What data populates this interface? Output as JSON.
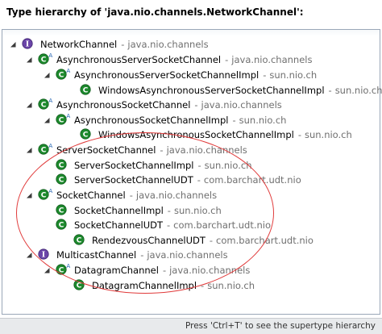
{
  "header": {
    "title": "Type hierarchy of 'java.nio.channels.NetworkChannel':"
  },
  "tree": {
    "rows": [
      {
        "name": "NetworkChannel",
        "pkg": "java.nio.channels",
        "icon": "interface-icon"
      },
      {
        "name": "AsynchronousServerSocketChannel",
        "pkg": "java.nio.channels",
        "icon": "abstract-class-icon"
      },
      {
        "name": "AsynchronousServerSocketChannelImpl",
        "pkg": "sun.nio.ch",
        "icon": "abstract-class-icon"
      },
      {
        "name": "WindowsAsynchronousServerSocketChannelImpl",
        "pkg": "sun.nio.ch",
        "icon": "class-icon"
      },
      {
        "name": "AsynchronousSocketChannel",
        "pkg": "java.nio.channels",
        "icon": "abstract-class-icon"
      },
      {
        "name": "AsynchronousSocketChannelImpl",
        "pkg": "sun.nio.ch",
        "icon": "abstract-class-icon"
      },
      {
        "name": "WindowsAsynchronousSocketChannelImpl",
        "pkg": "sun.nio.ch",
        "icon": "class-icon"
      },
      {
        "name": "ServerSocketChannel",
        "pkg": "java.nio.channels",
        "icon": "abstract-class-icon"
      },
      {
        "name": "ServerSocketChannelImpl",
        "pkg": "sun.nio.ch",
        "icon": "class-icon"
      },
      {
        "name": "ServerSocketChannelUDT",
        "pkg": "com.barchart.udt.nio",
        "icon": "class-icon"
      },
      {
        "name": "SocketChannel",
        "pkg": "java.nio.channels",
        "icon": "abstract-class-icon"
      },
      {
        "name": "SocketChannelImpl",
        "pkg": "sun.nio.ch",
        "icon": "class-icon"
      },
      {
        "name": "SocketChannelUDT",
        "pkg": "com.barchart.udt.nio",
        "icon": "class-icon"
      },
      {
        "name": "RendezvousChannelUDT",
        "pkg": "com.barchart.udt.nio",
        "icon": "class-icon"
      },
      {
        "name": "MulticastChannel",
        "pkg": "java.nio.channels",
        "icon": "interface-icon"
      },
      {
        "name": "DatagramChannel",
        "pkg": "java.nio.channels",
        "icon": "abstract-class-icon"
      },
      {
        "name": "DatagramChannelImpl",
        "pkg": "sun.nio.ch",
        "icon": "class-icon"
      }
    ],
    "separator": "-"
  },
  "status": {
    "hint": "Press 'Ctrl+T' to see the supertype hierarchy"
  },
  "colors": {
    "class_green": "#1e8a2e",
    "interface_purple": "#6b45a8",
    "annotation_red": "#e03a3a"
  }
}
